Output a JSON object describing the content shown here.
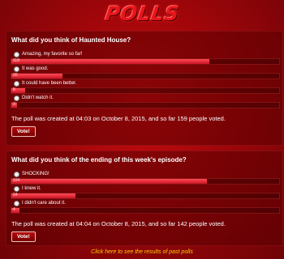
{
  "header": {
    "logo_text": "POLLS"
  },
  "polls": [
    {
      "question": "What did you think of Haunted House?",
      "options": [
        {
          "label": "Amazing, my favorite so far!",
          "count": "118",
          "fraction": 0.74
        },
        {
          "label": "It was good.",
          "count": "30",
          "fraction": 0.19
        },
        {
          "label": "It could have been better.",
          "count": "8",
          "fraction": 0.05
        },
        {
          "label": "Didn't watch it.",
          "count": "3",
          "fraction": 0.02
        }
      ],
      "summary": "The poll was created at 04:03 on October 8, 2015, and so far 159 people voted.",
      "vote_label": "Vote!"
    },
    {
      "question": "What did you think of the ending of this week's episode?",
      "options": [
        {
          "label": "SHOCKING!",
          "count": "104",
          "fraction": 0.73
        },
        {
          "label": "I knew it.",
          "count": "34",
          "fraction": 0.24
        },
        {
          "label": "I didn't care about it.",
          "count": "4",
          "fraction": 0.03
        }
      ],
      "summary": "The poll was created at 04:04 on October 8, 2015, and so far 142 people voted.",
      "vote_label": "Vote!"
    }
  ],
  "past_polls_link": "Click here to see the results of past polls"
}
